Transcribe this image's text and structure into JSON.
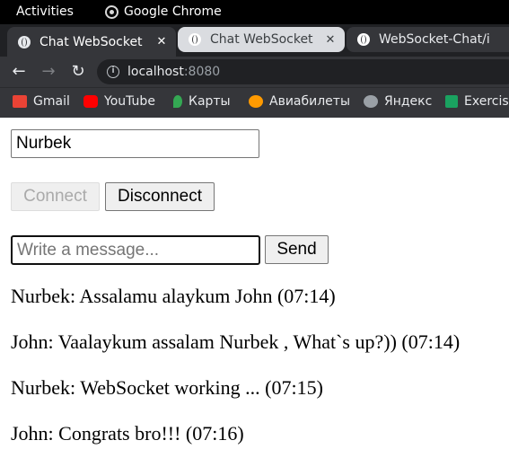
{
  "os_bar": {
    "activities": "Activities",
    "app_name": "Google Chrome"
  },
  "tabs": [
    {
      "title": "Chat WebSocket",
      "active": true
    },
    {
      "title": "Chat WebSocket",
      "active": false
    },
    {
      "title": "WebSocket-Chat/i",
      "active": false
    }
  ],
  "omnibox": {
    "host": "localhost",
    "port": ":8080"
  },
  "bookmarks": [
    {
      "label": "Gmail",
      "icon": "gmail-icon",
      "color": "#ea4335"
    },
    {
      "label": "YouTube",
      "icon": "youtube-icon",
      "color": "#ff0000"
    },
    {
      "label": "Карты",
      "icon": "maps-icon",
      "color": "#34a853"
    },
    {
      "label": "Авиабилеты",
      "icon": "aviasales-icon",
      "color": "#ff9a00"
    },
    {
      "label": "Яндекс",
      "icon": "globe-icon",
      "color": "#9aa0a6"
    },
    {
      "label": "Exercis",
      "icon": "exercism-icon",
      "color": "#1aa260"
    }
  ],
  "chat": {
    "name_value": "Nurbek",
    "connect_label": "Connect",
    "disconnect_label": "Disconnect",
    "message_placeholder": "Write a message...",
    "send_label": "Send",
    "messages": [
      "Nurbek: Assalamu alaykum John (07:14)",
      "John: Vaalaykum assalam Nurbek , What`s up?)) (07:14)",
      "Nurbek: WebSocket working ... (07:15)",
      "John: Congrats bro!!! (07:16)"
    ]
  }
}
